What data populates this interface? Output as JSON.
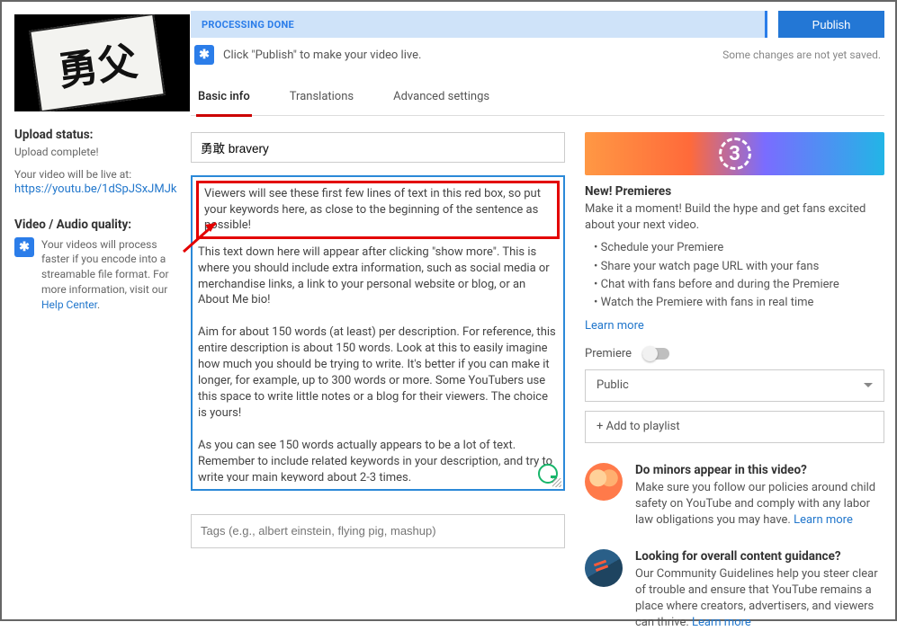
{
  "left": {
    "upload_status_h": "Upload status:",
    "upload_complete": "Upload complete!",
    "live_at": "Your video will be live at:",
    "video_url": "https://youtu.be/1dSpJSxJMJk",
    "quality_h": "Video / Audio quality:",
    "quality_msg": "Your videos will process faster if you encode into a streamable file format. For more information, visit our ",
    "help_center": "Help Center"
  },
  "top": {
    "processing": "PROCESSING DONE",
    "publish": "Publish",
    "hint": "Click \"Publish\" to make your video live.",
    "saved": "Some changes are not yet saved."
  },
  "tabs": {
    "basic": "Basic info",
    "trans": "Translations",
    "adv": "Advanced settings"
  },
  "form": {
    "title": "勇敢 bravery",
    "red_line": "Viewers will see these first few lines of text in this red box, so put your keywords here, as close to the beginning of the sentence as possible!",
    "desc_rest": "This text down here will appear after clicking \"show more\". This is where you should include extra information, such as social media or merchandise links, a link to your personal website or blog, or an About Me bio!\n\nAim for about 150 words (at least) per description. For reference, this entire description is about 150 words. Look at this to easily imagine how much you should be trying to write. It's better if you can make it longer, for example, up to 300 words or more. Some YouTubers use this space to write little notes or a blog for their viewers. The choice is yours!\n\nAs you can see 150 words actually appears to be a lot of text. Remember to include related keywords in your description, and try to write your main keyword about 2-3 times.",
    "tags_ph": "Tags (e.g., albert einstein, flying pig, mashup)"
  },
  "right": {
    "banner_num": "3",
    "prem_h": "New! Premieres",
    "prem_desc": "Make it a moment! Build the hype and get fans excited about your next video.",
    "bullets": [
      "Schedule your Premiere",
      "Share your watch page URL with your fans",
      "Chat with fans before and during the Premiere",
      "Watch the Premiere with fans in real time"
    ],
    "learn": "Learn more",
    "premiere_label": "Premiere",
    "visibility": "Public",
    "playlist": "+ Add to playlist",
    "minors_h": "Do minors appear in this video?",
    "minors_p": "Make sure you follow our policies around child safety on YouTube and comply with any labor law obligations you may have. ",
    "guide_h": "Looking for overall content guidance?",
    "guide_p": "Our Community Guidelines help you steer clear of trouble and ensure that YouTube remains a place where creators, advertisers, and viewers can thrive. "
  }
}
